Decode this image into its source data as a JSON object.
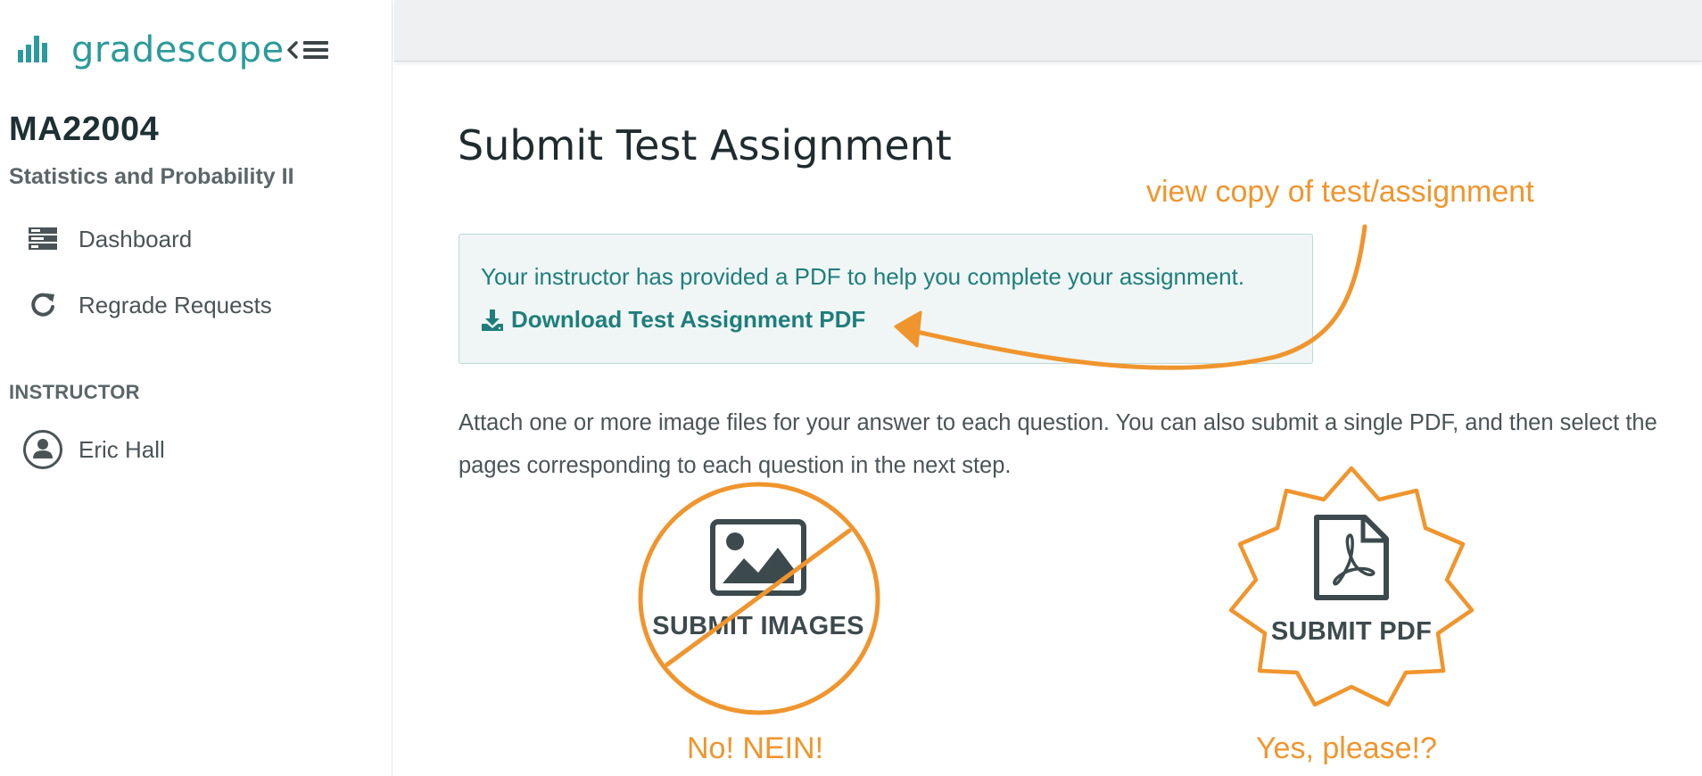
{
  "brand": {
    "name": "gradescope",
    "color": "#2c9a9a"
  },
  "course": {
    "code": "MA22004",
    "name": "Statistics and Probability II"
  },
  "nav": {
    "items": [
      {
        "label": "Dashboard",
        "icon": "dashboard-icon"
      },
      {
        "label": "Regrade Requests",
        "icon": "refresh-icon"
      }
    ]
  },
  "instructor": {
    "section_label": "INSTRUCTOR",
    "name": "Eric Hall",
    "icon": "user-avatar-icon"
  },
  "main": {
    "title": "Submit Test Assignment",
    "pdf_notice": {
      "message": "Your instructor has provided a PDF to help you complete your assignment.",
      "download_label": "Download Test Assignment PDF"
    },
    "instructions": "Attach one or more image files for your answer to each question. You can also submit a single PDF, and then select the pages corresponding to each question in the next step.",
    "options": [
      {
        "label": "SUBMIT IMAGES",
        "icon": "image-icon"
      },
      {
        "label": "SUBMIT PDF",
        "icon": "pdf-file-icon"
      }
    ]
  },
  "annotations": {
    "color": "#f0952d",
    "pdf_hint": "view copy of test/assignment",
    "images_verdict": "No! NEIN!",
    "pdf_verdict": "Yes, please!?"
  }
}
